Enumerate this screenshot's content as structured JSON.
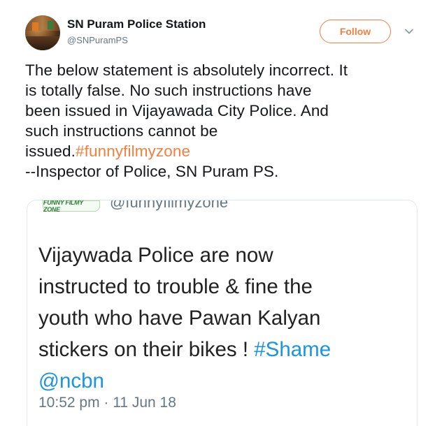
{
  "author": {
    "name": "SN Puram Police Station",
    "handle": "@SNPuramPS"
  },
  "follow_button": {
    "label": "Follow"
  },
  "colors": {
    "accent": "#f47f3e",
    "link": "#1b95e0",
    "muted": "#657786"
  },
  "icons": {
    "menu": "chevron-down-icon"
  },
  "tweet": {
    "lines": [
      "The below statement is absolutely incorrect. It",
      "is totally false. No such instructions have",
      "been issued in Vijayawada City Police. And",
      "such instructions cannot be"
    ],
    "line5_prefix": "issued.",
    "hashtag": "#funnyfilmyzone",
    "line6": "--Inspector of Police, SN Puram PS."
  },
  "embedded": {
    "logo_text": "FUNNY FILMY ZONE",
    "handle": "@funnyfilmyzone",
    "lines": [
      "Vijaywada Police are now",
      "instructed to trouble & fine the",
      "youth who have Pawan Kalyan"
    ],
    "line4_prefix": "stickers on their bikes ! ",
    "hashtag": "#Shame",
    "mention": "@ncbn",
    "timestamp": "10:52 pm · 11 Jun 18"
  }
}
